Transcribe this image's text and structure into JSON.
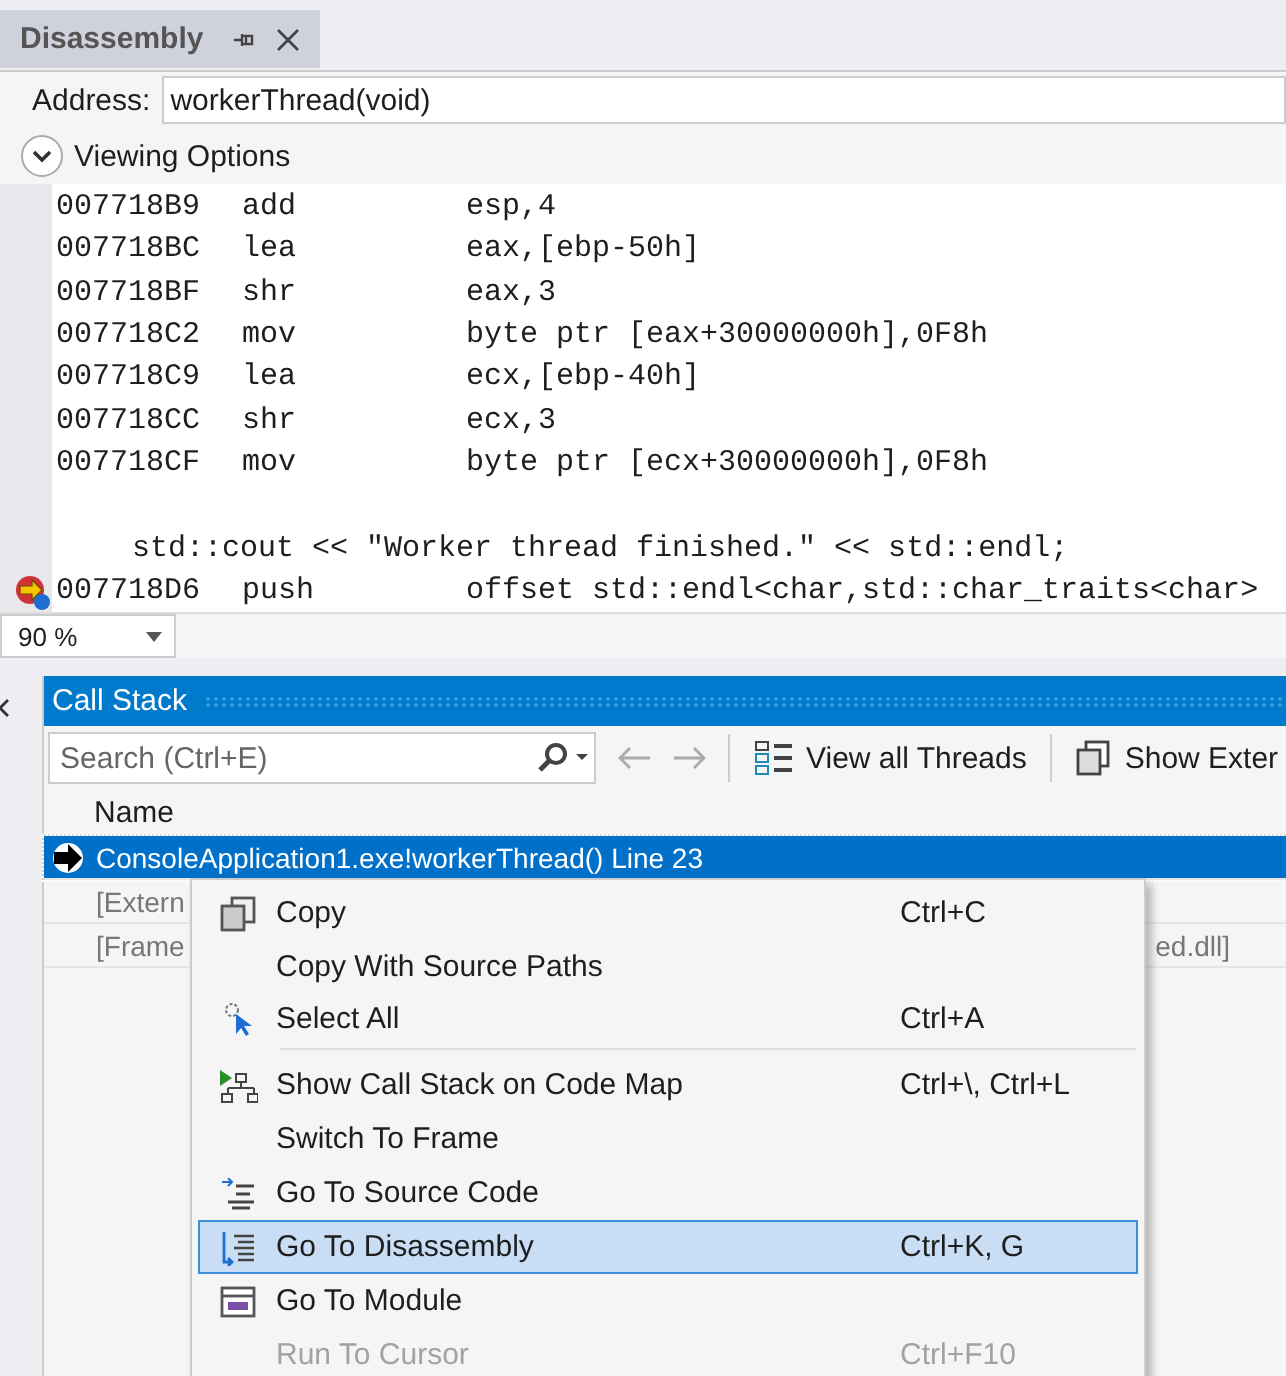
{
  "disassembly_tab": {
    "title": "Disassembly",
    "selected": true
  },
  "address": {
    "label": "Address:",
    "value": "workerThread(void)"
  },
  "viewing_options": {
    "label": "Viewing Options",
    "expanded": false
  },
  "code_lines": [
    {
      "kind": "instruction",
      "address": "007718B9",
      "mnemonic": "add",
      "operands": "esp,4",
      "current": false
    },
    {
      "kind": "instruction",
      "address": "007718BC",
      "mnemonic": "lea",
      "operands": "eax,[ebp-50h]",
      "current": false
    },
    {
      "kind": "instruction",
      "address": "007718BF",
      "mnemonic": "shr",
      "operands": "eax,3",
      "current": false
    },
    {
      "kind": "instruction",
      "address": "007718C2",
      "mnemonic": "mov",
      "operands": "byte ptr [eax+30000000h],0F8h",
      "current": false
    },
    {
      "kind": "instruction",
      "address": "007718C9",
      "mnemonic": "lea",
      "operands": "ecx,[ebp-40h]",
      "current": false
    },
    {
      "kind": "instruction",
      "address": "007718CC",
      "mnemonic": "shr",
      "operands": "ecx,3",
      "current": false
    },
    {
      "kind": "instruction",
      "address": "007718CF",
      "mnemonic": "mov",
      "operands": "byte ptr [ecx+30000000h],0F8h",
      "current": false
    },
    {
      "kind": "blank"
    },
    {
      "kind": "source",
      "text": "std::cout << \"Worker thread finished.\" << std::endl;"
    },
    {
      "kind": "instruction",
      "address": "007718D6",
      "mnemonic": "push",
      "operands": "offset std::endl<char,std::char_traits<char>",
      "current": true
    }
  ],
  "zoom": {
    "value": "90 %"
  },
  "call_stack": {
    "title": "Call Stack",
    "search": {
      "placeholder": "Search (Ctrl+E)"
    },
    "toolbar": [
      {
        "label": "View all Threads"
      },
      {
        "label": "Show Exter"
      }
    ],
    "columns": [
      "Name"
    ],
    "rows": [
      {
        "text": "ConsoleApplication1.exe!workerThread() Line 23",
        "selected": true,
        "current": true
      },
      {
        "text": "[Extern",
        "selected": false,
        "current": false
      },
      {
        "text": "[Frame",
        "tail": "ed.dll]",
        "selected": false,
        "current": false
      }
    ]
  },
  "context_menu": {
    "items": [
      {
        "label": "Copy",
        "shortcut": "Ctrl+C",
        "selected": false,
        "disabled": false,
        "separator_after": false
      },
      {
        "label": "Copy With Source Paths",
        "selected": false,
        "disabled": false,
        "separator_after": false
      },
      {
        "label": "Select All",
        "shortcut": "Ctrl+A",
        "selected": false,
        "disabled": false,
        "separator_after": true
      },
      {
        "label": "Show Call Stack on Code Map",
        "shortcut": "Ctrl+\\, Ctrl+L",
        "selected": false,
        "disabled": false,
        "separator_after": false
      },
      {
        "label": "Switch To Frame",
        "selected": false,
        "disabled": false,
        "separator_after": false
      },
      {
        "label": "Go To Source Code",
        "selected": false,
        "disabled": false,
        "separator_after": false
      },
      {
        "label": "Go To Disassembly",
        "shortcut": "Ctrl+K, G",
        "selected": true,
        "disabled": false,
        "separator_after": false
      },
      {
        "label": "Go To Module",
        "selected": false,
        "disabled": false,
        "separator_after": false
      },
      {
        "label": "Run To Cursor",
        "shortcut": "Ctrl+F10",
        "selected": false,
        "disabled": true,
        "separator_after": false
      }
    ]
  }
}
